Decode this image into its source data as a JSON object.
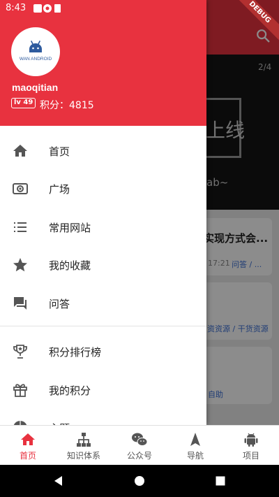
{
  "status_bar": {
    "time": "8:43"
  },
  "background": {
    "debug_label": "DEBUG",
    "banner_text": "上线",
    "banner_subtext": "ab~",
    "pager": "2/4",
    "article_title": "实现方式会...",
    "article_time": "17:21",
    "article_tag": "问答 / ...",
    "article2_tag": "资资源 / 干货资源",
    "article3_tag": "自助"
  },
  "drawer": {
    "avatar_text": "WAN ANDROID",
    "username": "maoqitian",
    "level": "lv 49",
    "points": "积分：4815",
    "menu": [
      {
        "label": "首页",
        "icon": "home-icon"
      },
      {
        "label": "广场",
        "icon": "square-icon"
      },
      {
        "label": "常用网站",
        "icon": "list-icon"
      },
      {
        "label": "我的收藏",
        "icon": "star-icon"
      },
      {
        "label": "问答",
        "icon": "forum-icon"
      },
      {
        "label": "积分排行榜",
        "icon": "trophy-icon"
      },
      {
        "label": "我的积分",
        "icon": "gift-icon"
      },
      {
        "label": "主题",
        "icon": "globe-icon"
      }
    ]
  },
  "bottom_nav": {
    "items": [
      {
        "label": "首页",
        "icon": "home-icon",
        "active": true
      },
      {
        "label": "知识体系",
        "icon": "hierarchy-icon"
      },
      {
        "label": "公众号",
        "icon": "wechat-icon"
      },
      {
        "label": "导航",
        "icon": "navigation-icon"
      },
      {
        "label": "项目",
        "icon": "android-icon"
      }
    ]
  },
  "colors": {
    "accent": "#e8323f",
    "icon_gray": "#555555"
  }
}
